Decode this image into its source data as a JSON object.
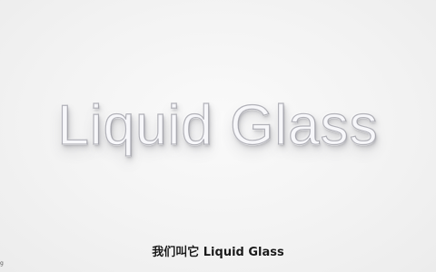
{
  "main": {
    "title": "Liquid Glass"
  },
  "caption": {
    "text": "我们叫它 Liquid Glass"
  },
  "corner": {
    "mark": "g"
  }
}
